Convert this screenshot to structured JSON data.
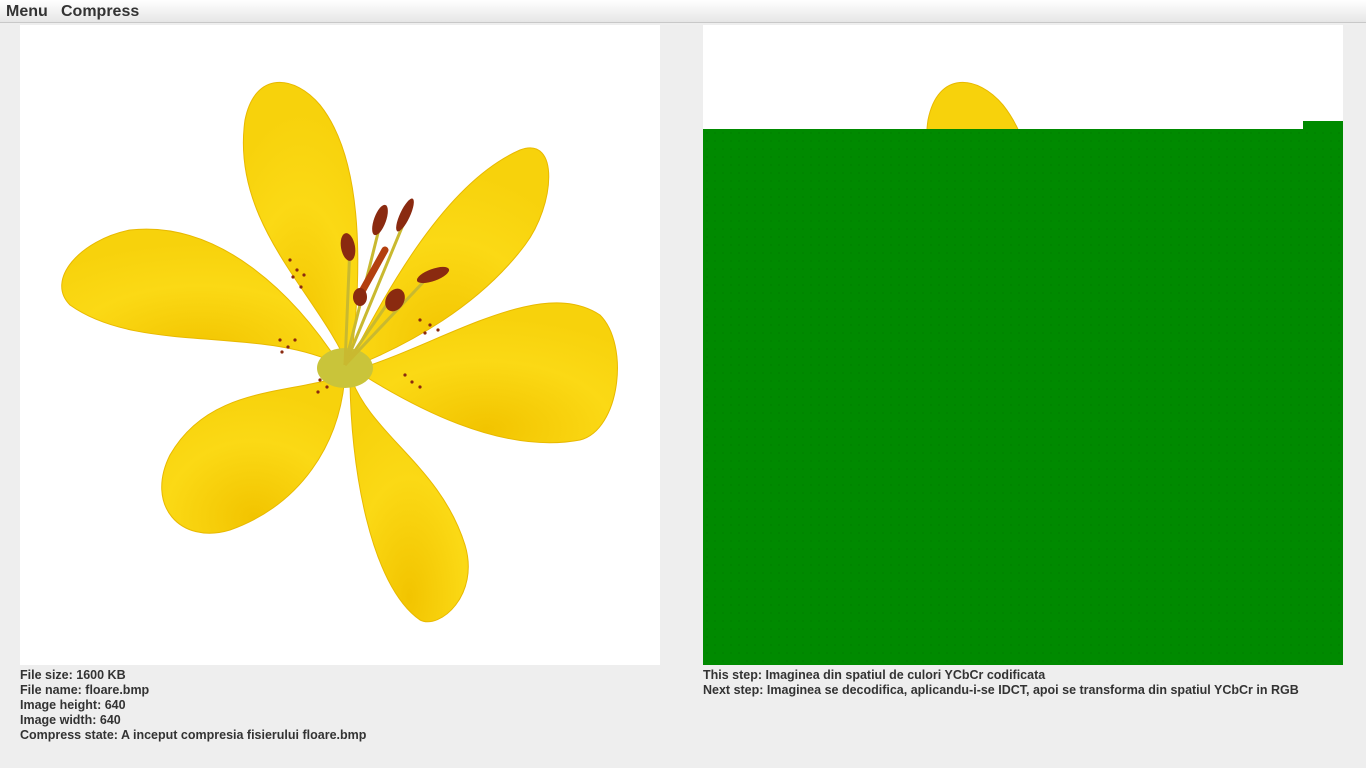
{
  "menubar": {
    "menu_label": "Menu",
    "compress_label": "Compress"
  },
  "file_info": {
    "file_size": "File size: 1600 KB",
    "file_name": "File name: floare.bmp",
    "image_height": "Image height: 640",
    "image_width": "Image width: 640",
    "compress_state": "Compress state: A inceput compresia fisierului floare.bmp"
  },
  "steps": {
    "this_step": "This step: Imaginea din spatiul de culori YCbCr codificata",
    "next_step": "Next step: Imaginea se decodifica, aplicandu-i-se IDCT, apoi se transforma din spatiul YCbCr in RGB"
  },
  "colors": {
    "petal_yellow": "#f6d511",
    "petal_shadow": "#e6b800",
    "center_green": "#b8c23a",
    "stamen_red": "#8a2a10",
    "overlay_green": "#008a00"
  }
}
